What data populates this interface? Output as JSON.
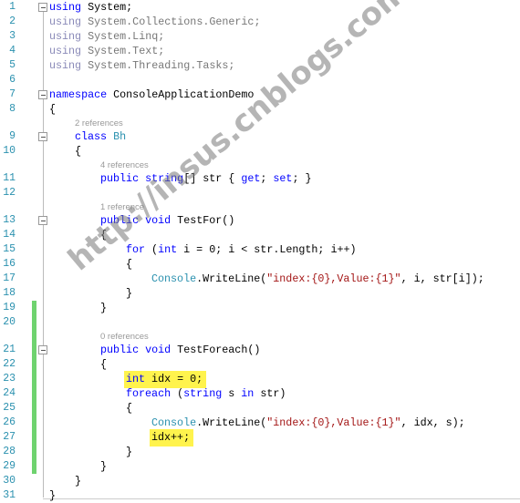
{
  "editor": {
    "language": "C#",
    "colors": {
      "keyword": "#0000ff",
      "type": "#2b91af",
      "string": "#a31515",
      "line_number": "#2b91af",
      "highlight": "#fff34d",
      "change_bar": "#6fd36f"
    },
    "lines": [
      {
        "num": "1",
        "indent": 0,
        "fold": true,
        "tokens": [
          {
            "t": "using",
            "c": "kw"
          },
          {
            "t": " System;"
          }
        ]
      },
      {
        "num": "2",
        "indent": 0,
        "tokens": [
          {
            "t": "using",
            "c": "fade"
          },
          {
            "t": " System.Collections.Generic;",
            "c": "fadep"
          }
        ]
      },
      {
        "num": "3",
        "indent": 0,
        "tokens": [
          {
            "t": "using",
            "c": "fade"
          },
          {
            "t": " System.Linq;",
            "c": "fadep"
          }
        ]
      },
      {
        "num": "4",
        "indent": 0,
        "tokens": [
          {
            "t": "using",
            "c": "fade"
          },
          {
            "t": " System.Text;",
            "c": "fadep"
          }
        ]
      },
      {
        "num": "5",
        "indent": 0,
        "tokens": [
          {
            "t": "using",
            "c": "fade"
          },
          {
            "t": " System.Threading.Tasks;",
            "c": "fadep"
          }
        ]
      },
      {
        "num": "6",
        "indent": 0,
        "tokens": []
      },
      {
        "num": "7",
        "indent": 0,
        "fold": true,
        "tokens": [
          {
            "t": "namespace",
            "c": "kw"
          },
          {
            "t": " ConsoleApplicationDemo"
          }
        ]
      },
      {
        "num": "8",
        "indent": 0,
        "tokens": [
          {
            "t": "{"
          }
        ]
      },
      {
        "num": "9",
        "indent": 1,
        "fold": true,
        "lens": "2 references",
        "tokens": [
          {
            "t": "class",
            "c": "kw"
          },
          {
            "t": " "
          },
          {
            "t": "Bh",
            "c": "ty"
          }
        ]
      },
      {
        "num": "10",
        "indent": 1,
        "tokens": [
          {
            "t": "{"
          }
        ]
      },
      {
        "num": "11",
        "indent": 2,
        "lens": "4 references",
        "tokens": [
          {
            "t": "public",
            "c": "kw"
          },
          {
            "t": " "
          },
          {
            "t": "string",
            "c": "kw"
          },
          {
            "t": "[] str { "
          },
          {
            "t": "get",
            "c": "kw"
          },
          {
            "t": "; "
          },
          {
            "t": "set",
            "c": "kw"
          },
          {
            "t": "; }"
          }
        ]
      },
      {
        "num": "12",
        "indent": 0,
        "tokens": []
      },
      {
        "num": "13",
        "indent": 2,
        "fold": true,
        "lens": "1 reference",
        "tokens": [
          {
            "t": "public",
            "c": "kw"
          },
          {
            "t": " "
          },
          {
            "t": "void",
            "c": "kw"
          },
          {
            "t": " TestFor()"
          }
        ]
      },
      {
        "num": "14",
        "indent": 2,
        "tokens": [
          {
            "t": "{"
          }
        ]
      },
      {
        "num": "15",
        "indent": 3,
        "tokens": [
          {
            "t": "for",
            "c": "kw"
          },
          {
            "t": " ("
          },
          {
            "t": "int",
            "c": "kw"
          },
          {
            "t": " i = 0; i < str.Length; i++)"
          }
        ]
      },
      {
        "num": "16",
        "indent": 3,
        "tokens": [
          {
            "t": "{"
          }
        ]
      },
      {
        "num": "17",
        "indent": 4,
        "tokens": [
          {
            "t": "Console",
            "c": "ty"
          },
          {
            "t": ".WriteLine("
          },
          {
            "t": "\"index:{0},Value:{1}\"",
            "c": "st"
          },
          {
            "t": ", i, str[i]);"
          }
        ]
      },
      {
        "num": "18",
        "indent": 3,
        "tokens": [
          {
            "t": "}"
          }
        ]
      },
      {
        "num": "19",
        "indent": 2,
        "changed": true,
        "tokens": [
          {
            "t": "}"
          }
        ]
      },
      {
        "num": "20",
        "indent": 0,
        "changed": true,
        "tokens": []
      },
      {
        "num": "21",
        "indent": 2,
        "fold": true,
        "changed": true,
        "lens": "0 references",
        "tokens": [
          {
            "t": "public",
            "c": "kw"
          },
          {
            "t": " "
          },
          {
            "t": "void",
            "c": "kw"
          },
          {
            "t": " TestForeach()"
          }
        ]
      },
      {
        "num": "22",
        "indent": 2,
        "changed": true,
        "tokens": [
          {
            "t": "{"
          }
        ]
      },
      {
        "num": "23",
        "indent": 3,
        "changed": true,
        "highlight": true,
        "tokens": [
          {
            "t": "int",
            "c": "kw"
          },
          {
            "t": " idx = 0;"
          }
        ]
      },
      {
        "num": "24",
        "indent": 3,
        "changed": true,
        "tokens": [
          {
            "t": "foreach",
            "c": "kw"
          },
          {
            "t": " ("
          },
          {
            "t": "string",
            "c": "kw"
          },
          {
            "t": " s "
          },
          {
            "t": "in",
            "c": "kw"
          },
          {
            "t": " str)"
          }
        ]
      },
      {
        "num": "25",
        "indent": 3,
        "changed": true,
        "tokens": [
          {
            "t": "{"
          }
        ]
      },
      {
        "num": "26",
        "indent": 4,
        "changed": true,
        "tokens": [
          {
            "t": "Console",
            "c": "ty"
          },
          {
            "t": ".WriteLine("
          },
          {
            "t": "\"index:{0},Value:{1}\"",
            "c": "st"
          },
          {
            "t": ", idx, s);"
          }
        ]
      },
      {
        "num": "27",
        "indent": 4,
        "changed": true,
        "highlight": true,
        "tokens": [
          {
            "t": "idx++;"
          }
        ]
      },
      {
        "num": "28",
        "indent": 3,
        "changed": true,
        "tokens": [
          {
            "t": "}"
          }
        ]
      },
      {
        "num": "29",
        "indent": 2,
        "changed": true,
        "tokens": [
          {
            "t": "}"
          }
        ]
      },
      {
        "num": "30",
        "indent": 1,
        "tokens": [
          {
            "t": "}"
          }
        ]
      },
      {
        "num": "31",
        "indent": 0,
        "tokens": [
          {
            "t": "}"
          }
        ]
      }
    ]
  },
  "watermark": "http://insus.cnblogs.com"
}
